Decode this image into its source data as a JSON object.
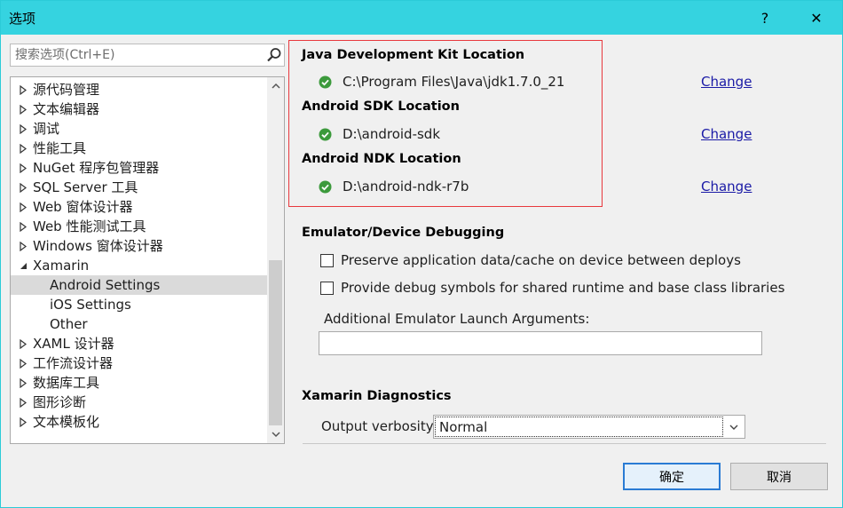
{
  "window": {
    "title": "选项",
    "help_label": "?",
    "close_label": "✕"
  },
  "search": {
    "placeholder": "搜索选项(Ctrl+E)"
  },
  "tree": {
    "items": [
      {
        "label": "源代码管理",
        "expanded": false
      },
      {
        "label": "文本编辑器",
        "expanded": false
      },
      {
        "label": "调试",
        "expanded": false
      },
      {
        "label": "性能工具",
        "expanded": false
      },
      {
        "label": "NuGet 程序包管理器",
        "expanded": false
      },
      {
        "label": "SQL Server 工具",
        "expanded": false
      },
      {
        "label": "Web 窗体设计器",
        "expanded": false
      },
      {
        "label": "Web 性能测试工具",
        "expanded": false
      },
      {
        "label": "Windows 窗体设计器",
        "expanded": false
      },
      {
        "label": "Xamarin",
        "expanded": true
      },
      {
        "label": "Android Settings",
        "child": true,
        "selected": true
      },
      {
        "label": "iOS Settings",
        "child": true
      },
      {
        "label": "Other",
        "child": true
      },
      {
        "label": "XAML 设计器",
        "expanded": false
      },
      {
        "label": "工作流设计器",
        "expanded": false
      },
      {
        "label": "数据库工具",
        "expanded": false
      },
      {
        "label": "图形诊断",
        "expanded": false
      },
      {
        "label": "文本模板化",
        "expanded": false
      }
    ]
  },
  "locations": {
    "jdk_title": "Java Development Kit Location",
    "jdk_path": "C:\\Program Files\\Java\\jdk1.7.0_21",
    "sdk_title": "Android SDK Location",
    "sdk_path": "D:\\android-sdk",
    "ndk_title": "Android NDK Location",
    "ndk_path": "D:\\android-ndk-r7b",
    "change_label": "Change"
  },
  "emulator": {
    "title": "Emulator/Device Debugging",
    "preserve_label": "Preserve application data/cache on device between deploys",
    "preserve_checked": false,
    "debug_symbols_label": "Provide debug symbols for shared runtime and base class libraries",
    "debug_symbols_checked": false,
    "args_label": "Additional Emulator Launch Arguments:",
    "args_value": ""
  },
  "diagnostics": {
    "title": "Xamarin Diagnostics",
    "verbosity_label": "Output verbosity:",
    "verbosity_value": "Normal"
  },
  "buttons": {
    "ok": "确定",
    "cancel": "取消"
  },
  "colors": {
    "titlebar": "#35d3e0",
    "highlight_border": "#e8383d",
    "check_green": "#3c9a3c",
    "link": "#1a1aa6"
  }
}
